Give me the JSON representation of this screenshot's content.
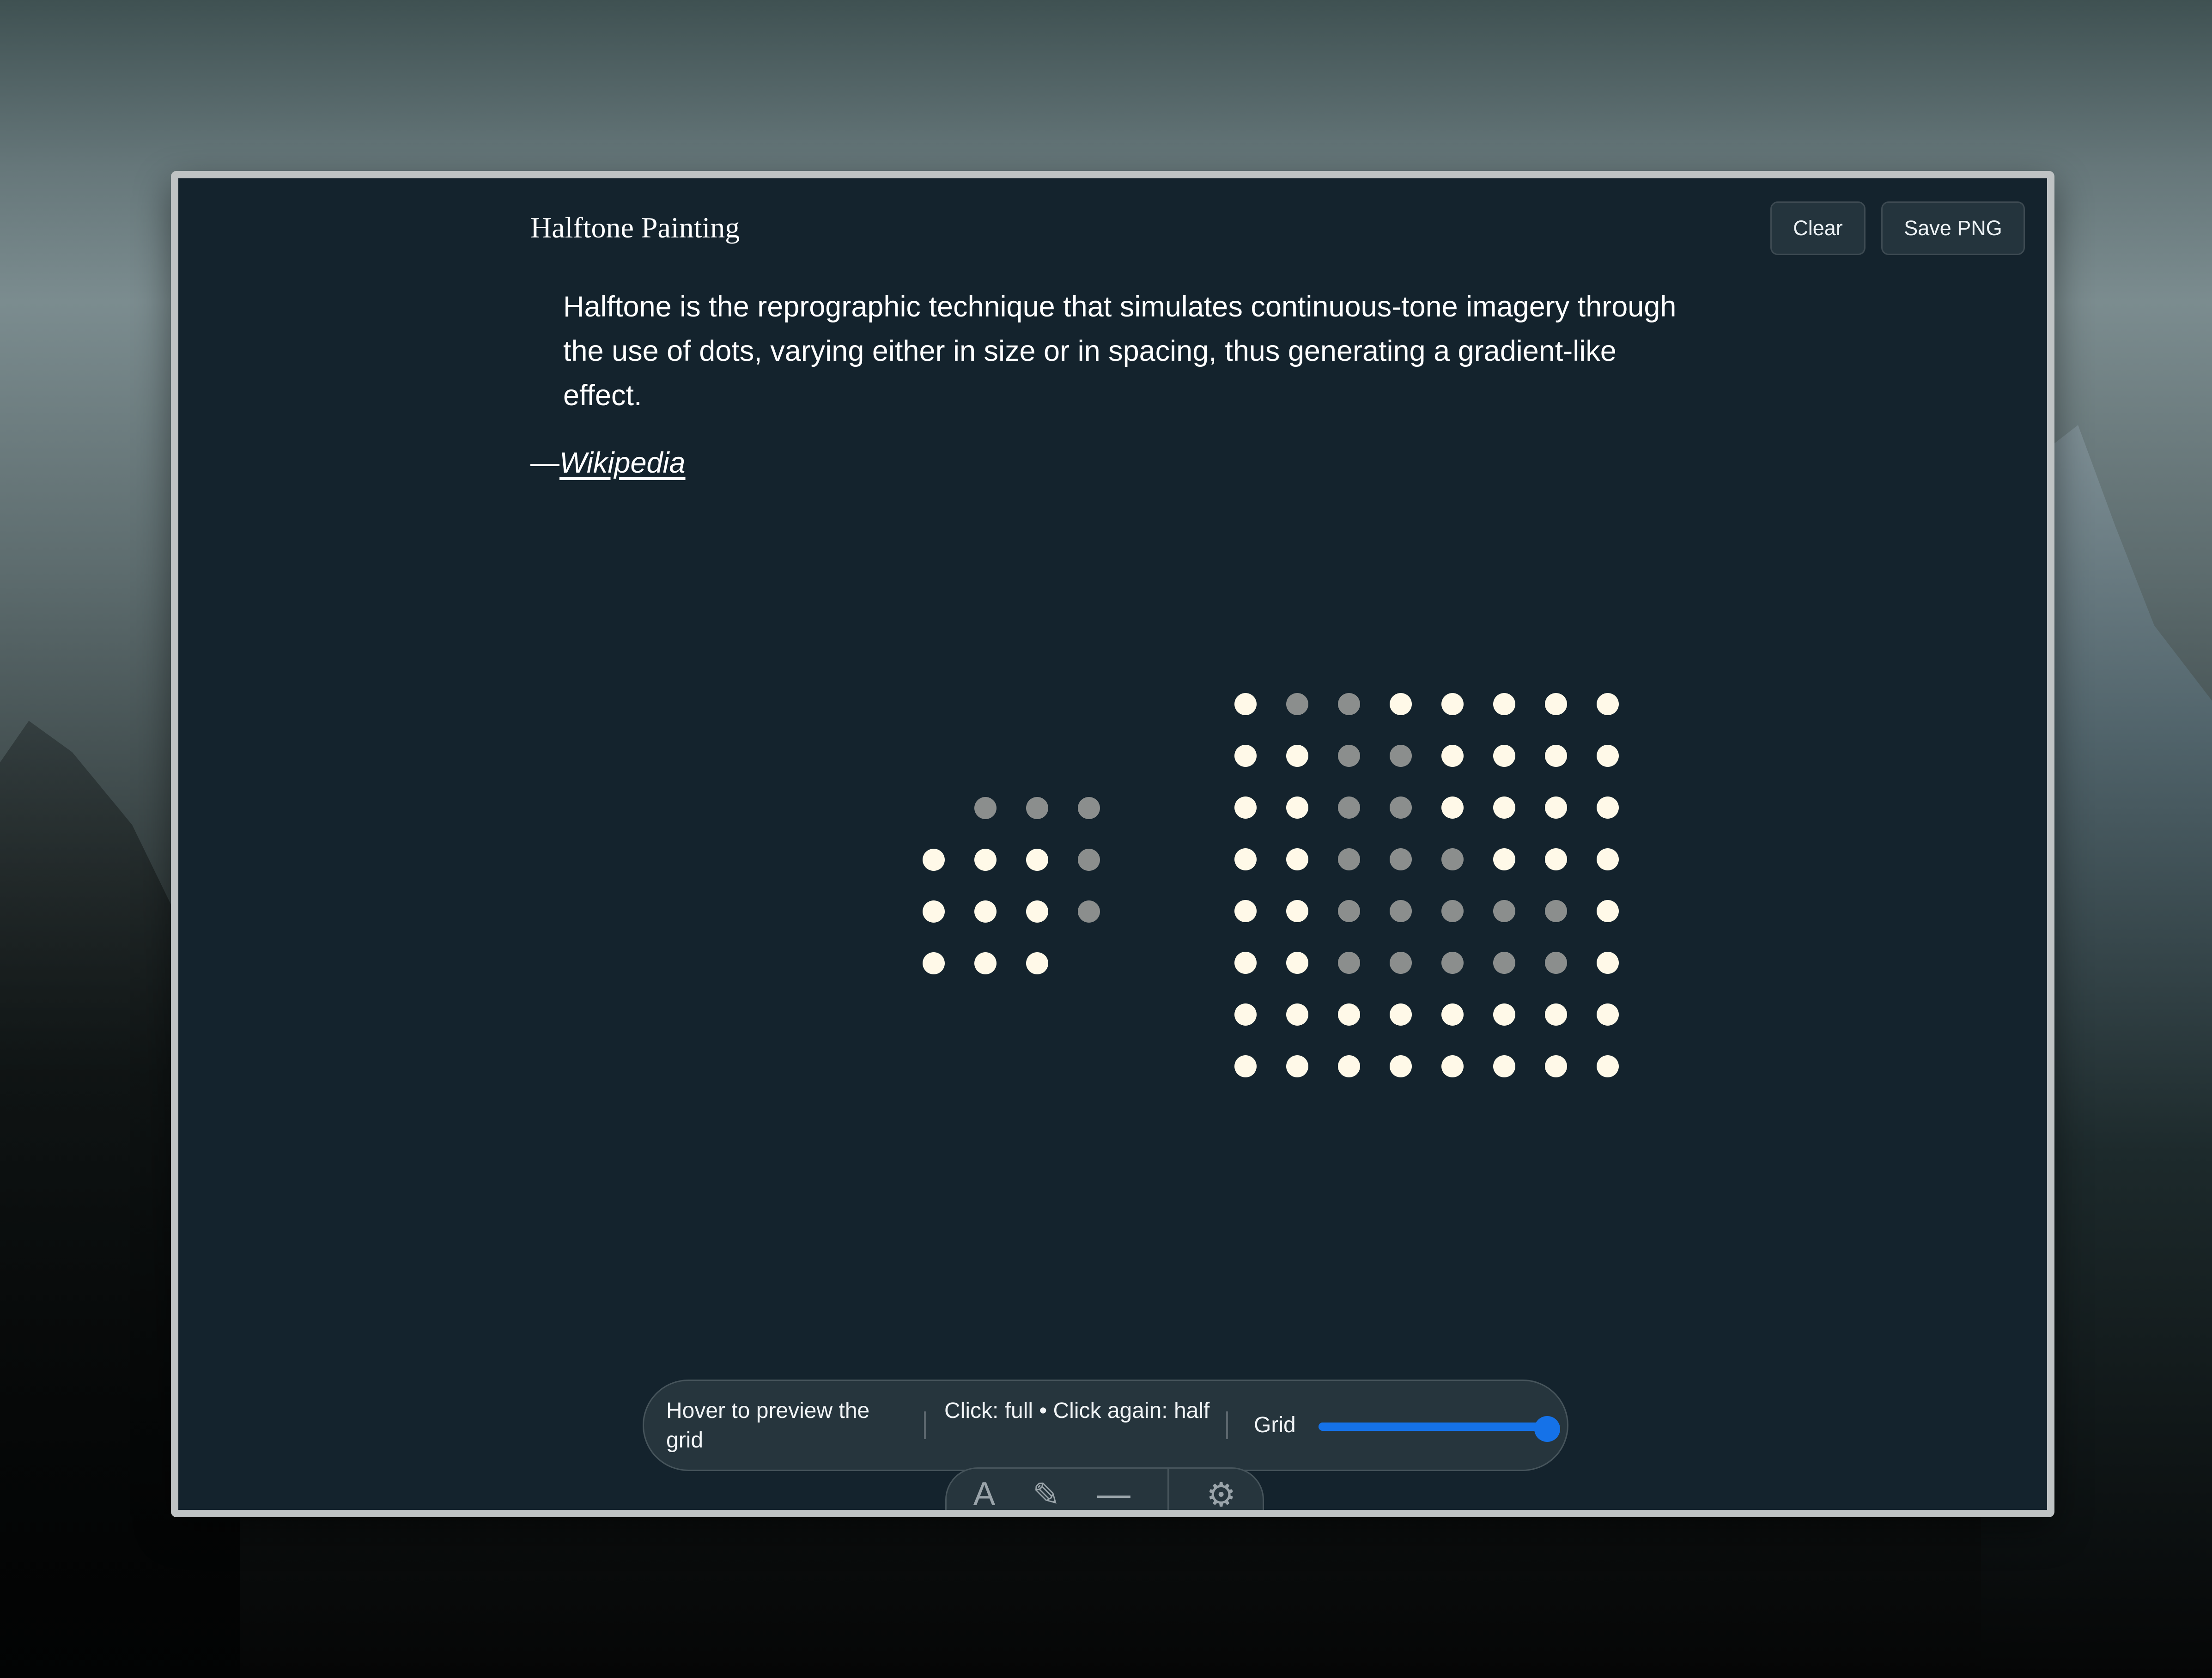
{
  "app": {
    "title": "Halftone Painting"
  },
  "toolbar": {
    "clear_label": "Clear",
    "save_label": "Save PNG"
  },
  "quote": {
    "text": "Halftone is the reprographic technique that simulates continuous-tone imagery through the use of dots, varying either in size or in spacing, thus generating a gradient-like effect.",
    "dash": "—",
    "source": "Wikipedia"
  },
  "halftone": {
    "dots_small": [
      [
        null,
        "half",
        "half",
        "half"
      ],
      [
        "full",
        "full",
        "full",
        "half"
      ],
      [
        "full",
        "full",
        "full",
        "half"
      ],
      [
        "full",
        "full",
        "full",
        null
      ]
    ],
    "dots_large": [
      [
        "full",
        "half",
        "half",
        "full",
        "full",
        "full",
        "full",
        "full"
      ],
      [
        "full",
        "full",
        "half",
        "half",
        "full",
        "full",
        "full",
        "full"
      ],
      [
        "full",
        "full",
        "half",
        "half",
        "full",
        "full",
        "full",
        "full"
      ],
      [
        "full",
        "full",
        "half",
        "half",
        "half",
        "full",
        "full",
        "full"
      ],
      [
        "full",
        "full",
        "half",
        "half",
        "half",
        "half",
        "half",
        "full"
      ],
      [
        "full",
        "full",
        "half",
        "half",
        "half",
        "half",
        "half",
        "full"
      ],
      [
        "full",
        "full",
        "full",
        "full",
        "full",
        "full",
        "full",
        "full"
      ],
      [
        "full",
        "full",
        "full",
        "full",
        "full",
        "full",
        "full",
        "full"
      ]
    ]
  },
  "hud": {
    "hover_hint": "Hover to preview the grid",
    "click_hint": "Click: full • Click again: half",
    "grid_label": "Grid",
    "grid_level": 0.97
  },
  "dock": {
    "icons": [
      "A",
      "✎",
      "—",
      "⚙"
    ]
  },
  "colors": {
    "background": "#14232d",
    "dot_full": "#fff9e8",
    "dot_half": "#8b8e8d",
    "accent": "#1572e8"
  }
}
